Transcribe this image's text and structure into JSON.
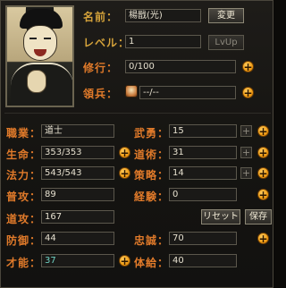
{
  "profile": {
    "name_label": "名前：",
    "name_value": "楊戩(光)",
    "change_label": "変更",
    "level_label": "レベル：",
    "level_value": "1",
    "levelup_label": "LvUp",
    "training_label": "修行：",
    "training_value": "0/100",
    "troops_label": "領兵：",
    "troops_value": "--/--"
  },
  "stats_left": [
    {
      "label": "職業：",
      "value": "道士"
    },
    {
      "label": "生命：",
      "value": "353/353"
    },
    {
      "label": "法力：",
      "value": "543/543"
    },
    {
      "label": "普攻：",
      "value": "89"
    },
    {
      "label": "道攻：",
      "value": "167"
    },
    {
      "label": "防御：",
      "value": "44"
    },
    {
      "label": "才能：",
      "value": "37"
    }
  ],
  "stats_right": [
    {
      "label": "武勇：",
      "value": "15"
    },
    {
      "label": "道術：",
      "value": "31"
    },
    {
      "label": "策略：",
      "value": "14"
    },
    {
      "label": "経験：",
      "value": "0"
    },
    {
      "label": "忠誠：",
      "value": "70"
    },
    {
      "label": "体給：",
      "value": "40"
    }
  ],
  "buttons": {
    "reset": "リセット",
    "save": "保存"
  },
  "icons": {
    "plus": "+",
    "small_plus": "+"
  }
}
